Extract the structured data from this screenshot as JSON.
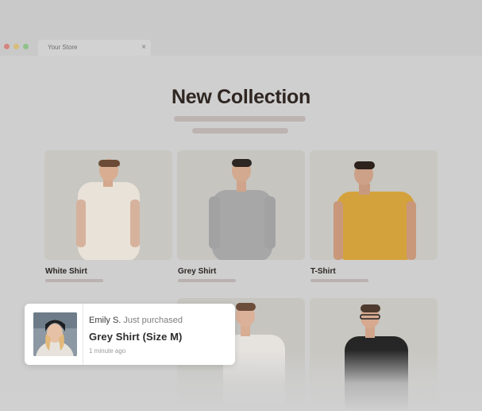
{
  "browser": {
    "tab_title": "Your Store",
    "tab_close": "×"
  },
  "page": {
    "title": "New Collection",
    "products": [
      {
        "label": "White Shirt"
      },
      {
        "label": "Grey Shirt"
      },
      {
        "label": "T-Shirt"
      }
    ]
  },
  "notification": {
    "customer": "Emily S.",
    "action": "Just purchased",
    "product": "Grey Shirt (Size M)",
    "time": "1 minute ago"
  },
  "colors": {
    "background": "#cfcfcf",
    "heading": "#2f2622",
    "card": "#c8c7c1",
    "popup": "#ffffff"
  }
}
